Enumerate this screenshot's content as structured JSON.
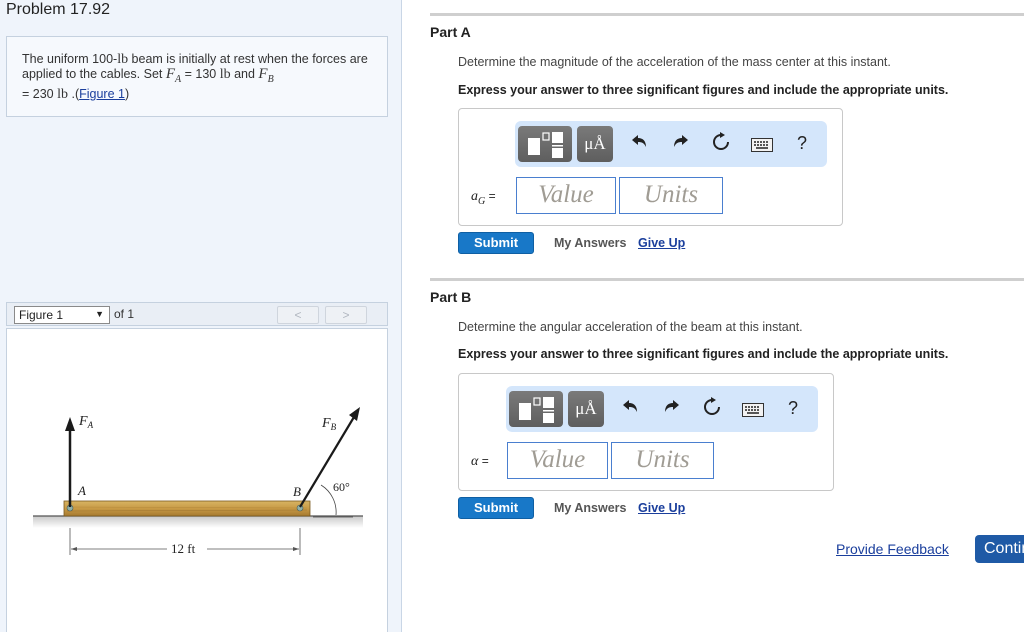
{
  "problem": {
    "title": "Problem 17.92",
    "statement_part1": "The uniform 100-",
    "unit_lb": "lb",
    "statement_part2": " beam is initially at rest when the forces are applied to the cables. Set ",
    "fa_symbol": "F",
    "fa_sub": "A",
    "fa_value": " = 130 ",
    "and_text": " and ",
    "fb_symbol": "F",
    "fb_sub": "B",
    "fb_value": " = 230 ",
    "dot": " .(",
    "figure_link": "Figure 1",
    "close_paren": ")"
  },
  "figure_nav": {
    "selected": "Figure 1",
    "of_text": "of 1",
    "prev_label": "<",
    "next_label": ">"
  },
  "figure": {
    "label_FA": "F",
    "label_FA_sub": "A",
    "label_FB": "F",
    "label_FB_sub": "B",
    "label_A": "A",
    "label_B": "B",
    "angle": "60°",
    "dimension": "12 ft"
  },
  "parts": [
    {
      "title": "Part A",
      "description": "Determine the magnitude of the acceleration of the mass center at this instant.",
      "instruction": "Express your answer to three significant figures and include the appropriate units.",
      "variable": "a",
      "variable_sub": "G",
      "equals": " =",
      "value_placeholder": "Value",
      "units_placeholder": "Units",
      "submit": "Submit",
      "my_answers": "My Answers",
      "give_up": "Give Up"
    },
    {
      "title": "Part B",
      "description": "Determine the angular acceleration of the beam at this instant.",
      "instruction": "Express your answer to three significant figures and include the appropriate units.",
      "variable": "α",
      "variable_sub": "",
      "equals": " =",
      "value_placeholder": "Value",
      "units_placeholder": "Units",
      "submit": "Submit",
      "my_answers": "My Answers",
      "give_up": "Give Up"
    }
  ],
  "toolbar": {
    "units_symbol": "μÅ",
    "help": "?"
  },
  "footer": {
    "feedback": "Provide Feedback",
    "continue": "Continue"
  }
}
